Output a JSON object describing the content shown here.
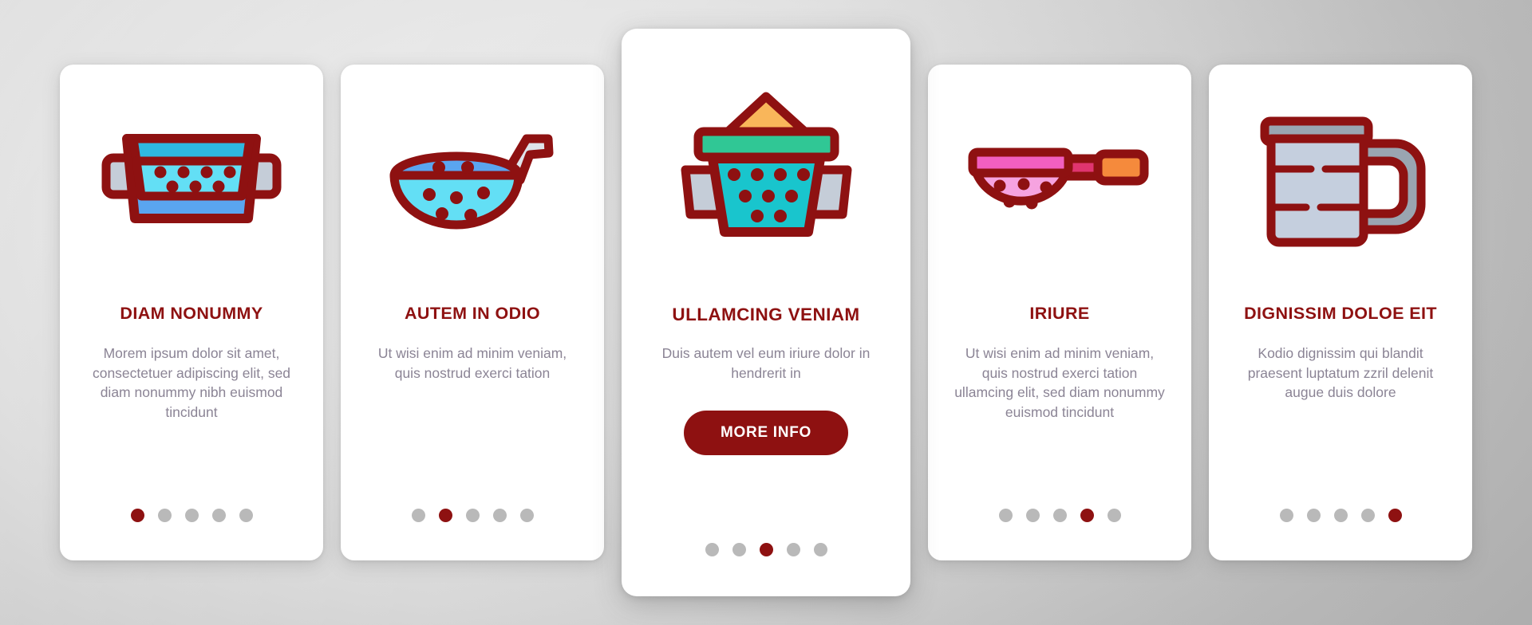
{
  "theme": {
    "accent": "#8e1111",
    "body_text": "#8b8495",
    "dot_inactive": "#b9b9b9",
    "card_bg": "#ffffff",
    "outline": "#8e1111"
  },
  "cards": [
    {
      "icon": "rectangular-colander-icon",
      "title": "DIAM NONUMMY",
      "body": "Morem ipsum dolor sit amet, consectetuer adipiscing elit, sed diam nonummy nibh euismod tincidunt",
      "dots_total": 5,
      "dot_active": 1,
      "featured": false,
      "button": null
    },
    {
      "icon": "ladle-skimmer-icon",
      "title": "AUTEM IN ODIO",
      "body": "Ut wisi enim ad minim veniam, quis nostrud exerci tation",
      "dots_total": 5,
      "dot_active": 2,
      "featured": false,
      "button": null
    },
    {
      "icon": "flour-sifter-icon",
      "title": "ULLAMCING VENIAM",
      "body": "Duis autem vel eum iriure dolor in hendrerit in",
      "dots_total": 5,
      "dot_active": 3,
      "featured": true,
      "button": "MORE INFO"
    },
    {
      "icon": "handled-strainer-icon",
      "title": "IRIURE",
      "body": "Ut wisi enim ad minim veniam, quis nostrud exerci tation ullamcing elit, sed diam nonummy euismod tincidunt",
      "dots_total": 5,
      "dot_active": 4,
      "featured": false,
      "button": null
    },
    {
      "icon": "measuring-jug-icon",
      "title": "DIGNISSIM DOLOE EIT",
      "body": "Kodio dignissim qui blandit praesent luptatum zzril delenit augue duis dolore",
      "dots_total": 5,
      "dot_active": 5,
      "featured": false,
      "button": null
    }
  ]
}
